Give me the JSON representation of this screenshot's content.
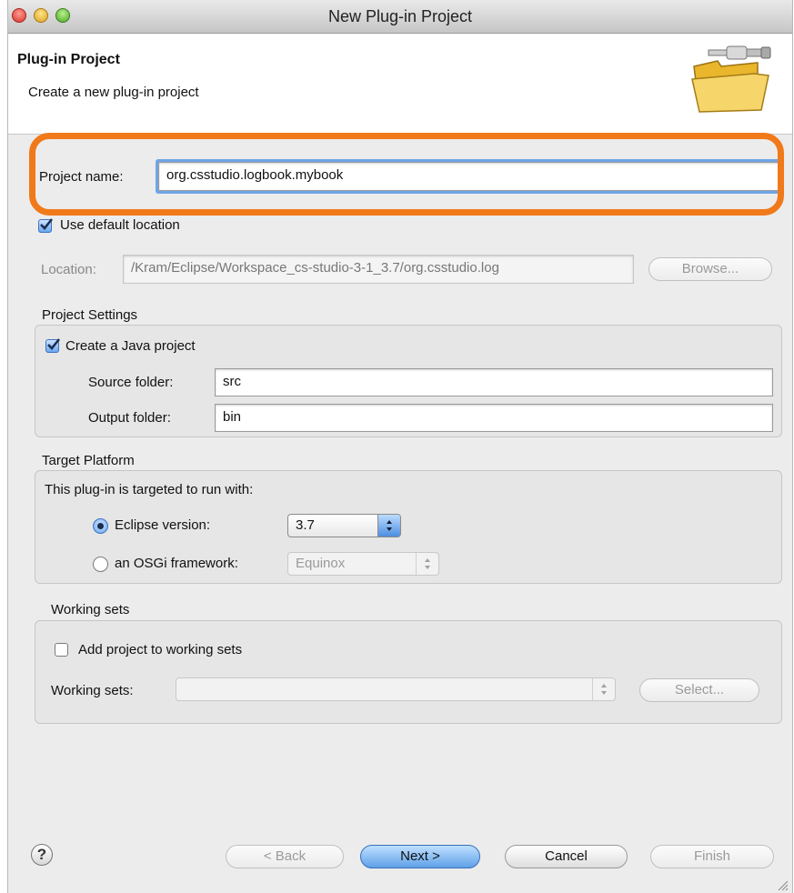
{
  "window": {
    "title": "New Plug-in Project"
  },
  "header": {
    "title": "Plug-in Project",
    "subtitle": "Create a new plug-in project",
    "icon": "wizard-folder-plug-icon"
  },
  "project": {
    "name_label": "Project name:",
    "name_value": "org.csstudio.logbook.mybook"
  },
  "location": {
    "use_default_label": "Use default location",
    "use_default_checked": true,
    "label": "Location:",
    "value": "/Kram/Eclipse/Workspace_cs-studio-3-1_3.7/org.csstudio.log",
    "browse_label": "Browse..."
  },
  "project_settings": {
    "group_title": "Project Settings",
    "java_label": "Create a Java project",
    "java_checked": true,
    "source_label": "Source folder:",
    "source_value": "src",
    "output_label": "Output folder:",
    "output_value": "bin"
  },
  "target_platform": {
    "group_title": "Target Platform",
    "intro": "This plug-in is targeted to run with:",
    "eclipse_label": "Eclipse version:",
    "eclipse_value": "3.7",
    "osgi_label": "an OSGi framework:",
    "osgi_value": "Equinox"
  },
  "working_sets": {
    "group_title": "Working sets",
    "add_label": "Add project to working sets",
    "add_checked": false,
    "label": "Working sets:",
    "value": "",
    "select_label": "Select..."
  },
  "footer": {
    "help": "?",
    "back": "< Back",
    "next": "Next >",
    "cancel": "Cancel",
    "finish": "Finish"
  },
  "colors": {
    "highlight": "#f07a1a",
    "focus": "#6fa5e8",
    "accent": "#5fa0e8"
  }
}
